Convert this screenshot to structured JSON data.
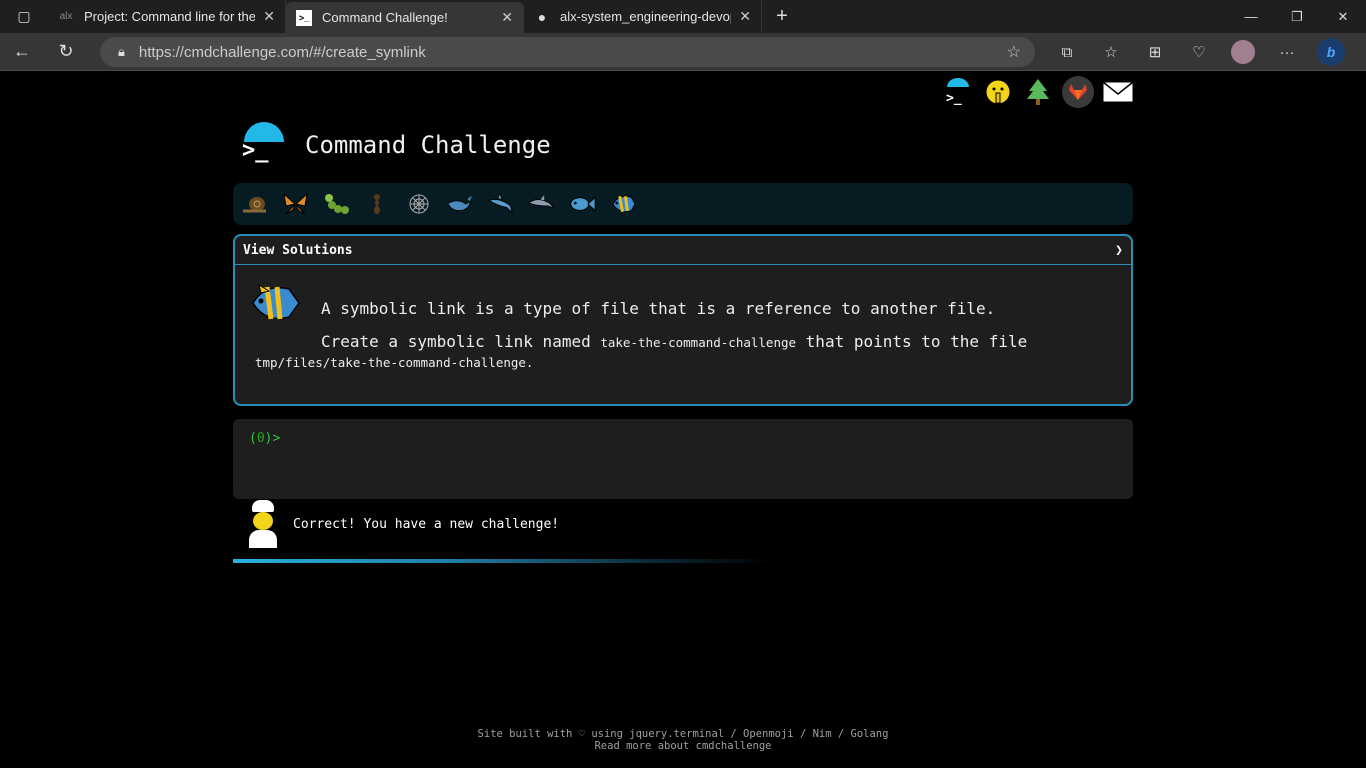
{
  "browser": {
    "tabs": [
      {
        "title": "Project: Command line for the",
        "favicon": "alx-icon",
        "active": false
      },
      {
        "title": "Command Challenge!",
        "favicon": "terminal-icon",
        "active": true
      },
      {
        "title": "alx-system_engineering-devop",
        "favicon": "github-icon",
        "active": false
      }
    ],
    "url": "https://cmdchallenge.com/#/create_symlink"
  },
  "header": {
    "site_title": "Command Challenge"
  },
  "levels": [
    "snail-icon",
    "butterfly-icon",
    "caterpillar-icon",
    "ant-icon",
    "spider-web-icon",
    "whale-icon",
    "shark-icon",
    "dolphin-icon",
    "fish-icon",
    "tropical-fish-icon"
  ],
  "challenge": {
    "view_solutions_label": "View Solutions",
    "line1": "A symbolic link is a type of file that is a reference to another file.",
    "line2_pre": "Create a symbolic link named",
    "line2_code": "take-the-command-challenge",
    "line2_post": "that points to the file",
    "line3_code": "tmp/files/take-the-command-challenge."
  },
  "terminal": {
    "prompt_open": "(",
    "prompt_count": "0",
    "prompt_close": ")>"
  },
  "feedback": {
    "message": "Correct! You have a new challenge!"
  },
  "progress": 0.45,
  "footer": {
    "line1": "Site built with ♡ using jquery.terminal / Openmoji / Nim / Golang",
    "line2": "Read more about cmdchallenge"
  },
  "colors": {
    "accent": "#2a8fb5",
    "prompt_green": "#27c93f",
    "logo_blue": "#22b8e8"
  }
}
